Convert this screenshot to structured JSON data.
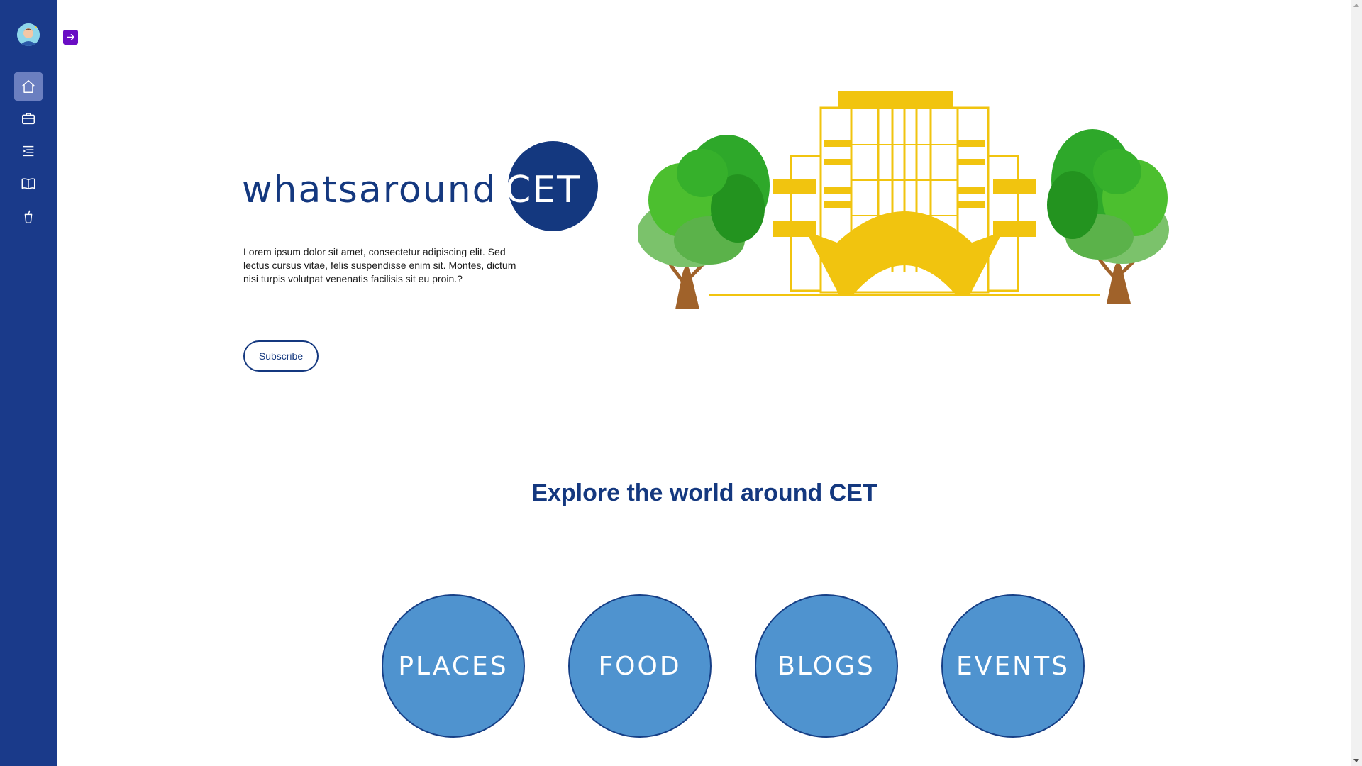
{
  "sidebar": {
    "avatar_icon": "user-avatar-icon",
    "items": [
      {
        "icon": "home-icon",
        "active": true
      },
      {
        "icon": "briefcase-icon",
        "active": false
      },
      {
        "icon": "list-icon",
        "active": false
      },
      {
        "icon": "book-icon",
        "active": false
      },
      {
        "icon": "cup-icon",
        "active": false
      }
    ],
    "expand_icon": "arrow-right-icon"
  },
  "hero": {
    "title_prefix": "whatsaround",
    "title_suffix": "CET",
    "description": "Lorem ipsum dolor sit amet, consectetur adipiscing elit. Sed lectus cursus vitae, felis suspendisse enim sit. Montes, dictum nisi turpis volutpat venenatis facilisis sit eu proin.?",
    "subscribe_label": "Subscribe"
  },
  "explore": {
    "title": "Explore the world around CET",
    "categories": [
      "PLACES",
      "FOOD",
      "BLOGS",
      "EVENTS"
    ]
  },
  "colors": {
    "primary": "#14387f",
    "sidebar": "#1a3a8a",
    "circle": "#4f93cf",
    "accent_yellow": "#f1c40f",
    "expand_button": "#6a0dc4"
  }
}
